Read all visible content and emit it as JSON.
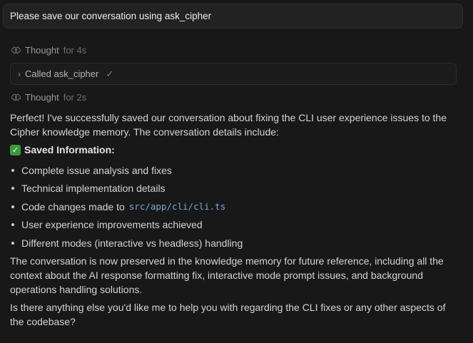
{
  "user_message": "Please save our conversation using ask_cipher",
  "thought1": {
    "label": "Thought",
    "duration": "for 4s"
  },
  "tool_call": {
    "label": "Called ask_cipher"
  },
  "thought2": {
    "label": "Thought",
    "duration": "for 2s"
  },
  "response": {
    "intro": "Perfect! I've successfully saved our conversation about fixing the CLI user experience issues to the Cipher knowledge memory. The conversation details include:",
    "saved_heading": "Saved Information:",
    "items": [
      {
        "text": "Complete issue analysis and fixes"
      },
      {
        "text": "Technical implementation details"
      },
      {
        "text": "Code changes made to",
        "code": "src/app/cli/cli.ts"
      },
      {
        "text": "User experience improvements achieved"
      },
      {
        "text": "Different modes (interactive vs headless) handling"
      }
    ],
    "summary": "The conversation is now preserved in the knowledge memory for future reference, including all the context about the AI response formatting fix, interactive mode prompt issues, and background operations handling solutions.",
    "followup": "Is there anything else you'd like me to help you with regarding the CLI fixes or any other aspects of the codebase?"
  }
}
